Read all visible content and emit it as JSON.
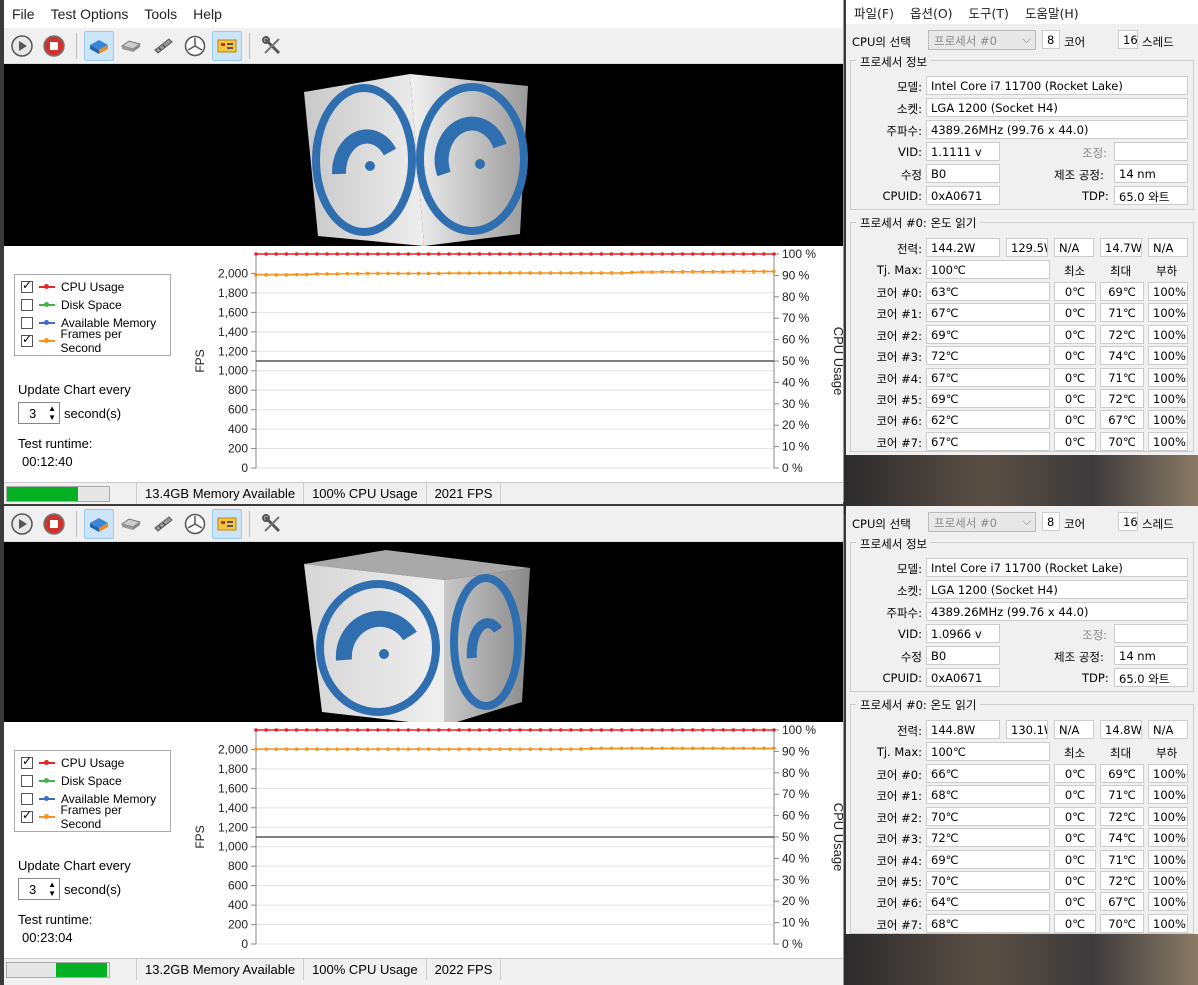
{
  "menu": [
    "File",
    "Test Options",
    "Tools",
    "Help"
  ],
  "legend": [
    {
      "label": "CPU Usage",
      "checked": true,
      "color": "#e8232a"
    },
    {
      "label": "Disk Space",
      "checked": false,
      "color": "#44b544"
    },
    {
      "label": "Available Memory",
      "checked": false,
      "color": "#3a6fc4"
    },
    {
      "label": "Frames per Second",
      "checked": true,
      "color": "#f7941d"
    }
  ],
  "update_label": "Update Chart every",
  "seconds_label": "second(s)",
  "runtime_label": "Test runtime:",
  "panels": [
    {
      "interval": "3",
      "runtime": "00:12:40",
      "memory": "13.4GB Memory Available",
      "cpu": "100% CPU Usage",
      "fps": "2021 FPS",
      "progress": 0.7,
      "progress_start": 0.0
    },
    {
      "interval": "3",
      "runtime": "00:23:04",
      "memory": "13.2GB Memory Available",
      "cpu": "100% CPU Usage",
      "fps": "2022 FPS",
      "progress": 0.5,
      "progress_start": 0.48
    }
  ],
  "chart_data": [
    {
      "type": "line",
      "ylabel_left": "FPS",
      "ylabel_right": "CPU Usage",
      "left_ticks": [
        "2,000",
        "1,800",
        "1,600",
        "1,400",
        "1,200",
        "1,000",
        "800",
        "600",
        "400",
        "200",
        "0"
      ],
      "right_ticks": [
        "100 %",
        "90 %",
        "80 %",
        "70 %",
        "60 %",
        "50 %",
        "40 %",
        "30 %",
        "20 %",
        "10 %",
        "0 %"
      ],
      "ylim_left": [
        0,
        2200
      ],
      "ylim_right": [
        0,
        100
      ],
      "series": [
        {
          "name": "CPU Usage",
          "axis": "right",
          "values": [
            100,
            100,
            100,
            100,
            100,
            100,
            100,
            100,
            100,
            100,
            100,
            100,
            100,
            100,
            100,
            100,
            100,
            100,
            100,
            100,
            100,
            100,
            100,
            100,
            100,
            100,
            100,
            100,
            100,
            100,
            100,
            100,
            100,
            100,
            100,
            100,
            100,
            100,
            100,
            100,
            100,
            100,
            100,
            100,
            100,
            100,
            100,
            100,
            100,
            100,
            100,
            100
          ]
        },
        {
          "name": "Frames per Second",
          "axis": "left",
          "values": [
            1985,
            1985,
            1985,
            1985,
            1988,
            1988,
            1995,
            1995,
            1995,
            1998,
            1998,
            2000,
            2000,
            2000,
            2000,
            2000,
            2000,
            2000,
            2000,
            2003,
            2003,
            2003,
            2003,
            2003,
            2005,
            2005,
            2005,
            2005,
            2005,
            2005,
            2005,
            2005,
            2005,
            2005,
            2005,
            2005,
            2005,
            2010,
            2015,
            2015,
            2018,
            2018,
            2018,
            2018,
            2018,
            2018,
            2018,
            2021,
            2021,
            2021,
            2021,
            2021
          ]
        }
      ],
      "midline_pct": 50
    },
    {
      "type": "line",
      "ylabel_left": "FPS",
      "ylabel_right": "CPU Usage",
      "left_ticks": [
        "2,000",
        "1,800",
        "1,600",
        "1,400",
        "1,200",
        "1,000",
        "800",
        "600",
        "400",
        "200",
        "0"
      ],
      "right_ticks": [
        "100 %",
        "90 %",
        "80 %",
        "70 %",
        "60 %",
        "50 %",
        "40 %",
        "30 %",
        "20 %",
        "10 %",
        "0 %"
      ],
      "ylim_left": [
        0,
        2200
      ],
      "ylim_right": [
        0,
        100
      ],
      "series": [
        {
          "name": "CPU Usage",
          "axis": "right",
          "values": [
            100,
            100,
            100,
            100,
            100,
            100,
            100,
            100,
            100,
            100,
            100,
            100,
            100,
            100,
            100,
            100,
            100,
            100,
            100,
            100,
            100,
            100,
            100,
            100,
            100,
            100,
            100,
            100,
            100,
            100,
            100,
            100,
            100,
            100,
            100,
            100,
            100,
            100,
            100,
            100,
            100,
            100,
            100,
            100,
            100,
            100,
            100,
            100,
            100,
            100,
            100,
            100
          ]
        },
        {
          "name": "Frames per Second",
          "axis": "left",
          "values": [
            2003,
            2003,
            2003,
            2003,
            2003,
            2003,
            2003,
            2003,
            2003,
            2003,
            2003,
            2003,
            2003,
            2003,
            2003,
            2003,
            2003,
            2003,
            2003,
            2003,
            2003,
            2003,
            2003,
            2003,
            2003,
            2003,
            2003,
            2003,
            2003,
            2003,
            2003,
            2003,
            2005,
            2010,
            2012,
            2012,
            2012,
            2012,
            2012,
            2012,
            2012,
            2012,
            2012,
            2012,
            2012,
            2012,
            2012,
            2012,
            2012,
            2012,
            2012,
            2012
          ]
        }
      ],
      "midline_pct": 50
    }
  ],
  "cpuz": {
    "menu": [
      "파일(F)",
      "옵션(O)",
      "도구(T)",
      "도움말(H)"
    ],
    "select_label": "CPU의 선택",
    "select_value": "프로세서 #0",
    "cores": "8",
    "cores_label": "코어",
    "threads": "16",
    "threads_label": "스레드",
    "info_title": "프로세서 정보",
    "model_label": "모델:",
    "socket_label": "소켓:",
    "freq_label": "주파수:",
    "vid_label": "VID:",
    "adjust_label": "조정:",
    "rev_label": "수정",
    "process_label": "제조 공정:",
    "cpuid_label": "CPUID:",
    "tdp_label": "TDP:",
    "temp_title": "프로세서 #0: 온도 읽기",
    "power_label": "전력:",
    "tjmax_label": "Tj. Max:",
    "min_label": "최소",
    "max_label": "최대",
    "load_label": "부하",
    "panels": [
      {
        "model": "Intel Core i7 11700 (Rocket Lake)",
        "socket": "LGA 1200 (Socket H4)",
        "freq": "4389.26MHz (99.76 x 44.0)",
        "vid": "1.1111 v",
        "rev": "B0",
        "process": "14 nm",
        "cpuid": "0xA0671",
        "tdp": "65.0 와트",
        "power": [
          "144.2W",
          "129.5W",
          "N/A",
          "14.7W",
          "N/A"
        ],
        "tjmax": "100℃",
        "cores": [
          {
            "label": "코어 #0:",
            "temp": "63℃",
            "min": "0℃",
            "max": "69℃",
            "load": "100%"
          },
          {
            "label": "코어 #1:",
            "temp": "67℃",
            "min": "0℃",
            "max": "71℃",
            "load": "100%"
          },
          {
            "label": "코어 #2:",
            "temp": "69℃",
            "min": "0℃",
            "max": "72℃",
            "load": "100%"
          },
          {
            "label": "코어 #3:",
            "temp": "72℃",
            "min": "0℃",
            "max": "74℃",
            "load": "100%"
          },
          {
            "label": "코어 #4:",
            "temp": "67℃",
            "min": "0℃",
            "max": "71℃",
            "load": "100%"
          },
          {
            "label": "코어 #5:",
            "temp": "69℃",
            "min": "0℃",
            "max": "72℃",
            "load": "100%"
          },
          {
            "label": "코어 #6:",
            "temp": "62℃",
            "min": "0℃",
            "max": "67℃",
            "load": "100%"
          },
          {
            "label": "코어 #7:",
            "temp": "67℃",
            "min": "0℃",
            "max": "70℃",
            "load": "100%"
          }
        ]
      },
      {
        "model": "Intel Core i7 11700 (Rocket Lake)",
        "socket": "LGA 1200 (Socket H4)",
        "freq": "4389.26MHz (99.76 x 44.0)",
        "vid": "1.0966 v",
        "rev": "B0",
        "process": "14 nm",
        "cpuid": "0xA0671",
        "tdp": "65.0 와트",
        "power": [
          "144.8W",
          "130.1W",
          "N/A",
          "14.8W",
          "N/A"
        ],
        "tjmax": "100℃",
        "cores": [
          {
            "label": "코어 #0:",
            "temp": "66℃",
            "min": "0℃",
            "max": "69℃",
            "load": "100%"
          },
          {
            "label": "코어 #1:",
            "temp": "68℃",
            "min": "0℃",
            "max": "71℃",
            "load": "100%"
          },
          {
            "label": "코어 #2:",
            "temp": "70℃",
            "min": "0℃",
            "max": "72℃",
            "load": "100%"
          },
          {
            "label": "코어 #3:",
            "temp": "72℃",
            "min": "0℃",
            "max": "74℃",
            "load": "100%"
          },
          {
            "label": "코어 #4:",
            "temp": "69℃",
            "min": "0℃",
            "max": "71℃",
            "load": "100%"
          },
          {
            "label": "코어 #5:",
            "temp": "70℃",
            "min": "0℃",
            "max": "72℃",
            "load": "100%"
          },
          {
            "label": "코어 #6:",
            "temp": "64℃",
            "min": "0℃",
            "max": "67℃",
            "load": "100%"
          },
          {
            "label": "코어 #7:",
            "temp": "68℃",
            "min": "0℃",
            "max": "70℃",
            "load": "100%"
          }
        ]
      }
    ]
  }
}
